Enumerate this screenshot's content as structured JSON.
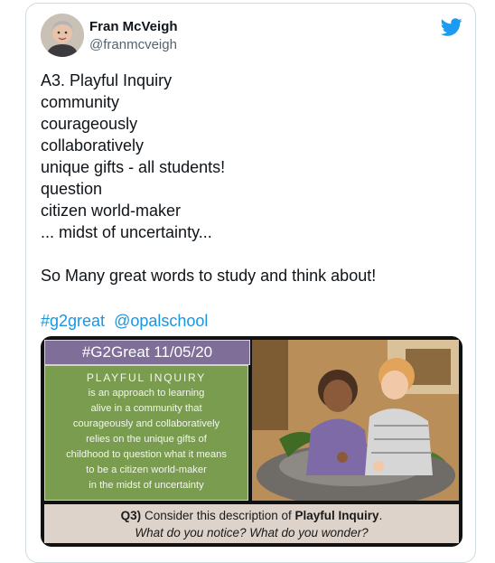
{
  "tweet": {
    "author_name": "Fran McVeigh",
    "author_handle": "@franmcveigh",
    "body": "A3. Playful Inquiry\ncommunity\ncourageously\ncollaboratively\nunique gifts - all students!\nquestion\ncitizen world-maker\n... midst of uncertainty...\n\nSo Many great words to study and think about!",
    "hashtag": "#g2great",
    "mention": "@opalschool"
  },
  "media": {
    "title": "#G2Great  11/05/20",
    "green_lines": [
      "PLAYFUL INQUIRY",
      "is an approach to learning",
      "alive in a community that",
      "courageously and collaboratively",
      "relies on the unique gifts of",
      "childhood to question what it means",
      "to be a citizen world-maker",
      "in the midst of uncertainty"
    ],
    "caption_q_label": "Q3)",
    "caption_line1_rest": " Consider this description of ",
    "caption_bold": "Playful Inquiry",
    "caption_period": ".",
    "caption_line2": "What do you notice? What do you wonder?"
  },
  "colors": {
    "twitter_blue": "#1d9bf0",
    "link_blue": "#1b95e0",
    "title_purple": "#7e6e98",
    "panel_green": "#7a9c4e",
    "caption_beige": "#ded3cb"
  },
  "icons": {
    "logo": "twitter-bird-icon"
  }
}
